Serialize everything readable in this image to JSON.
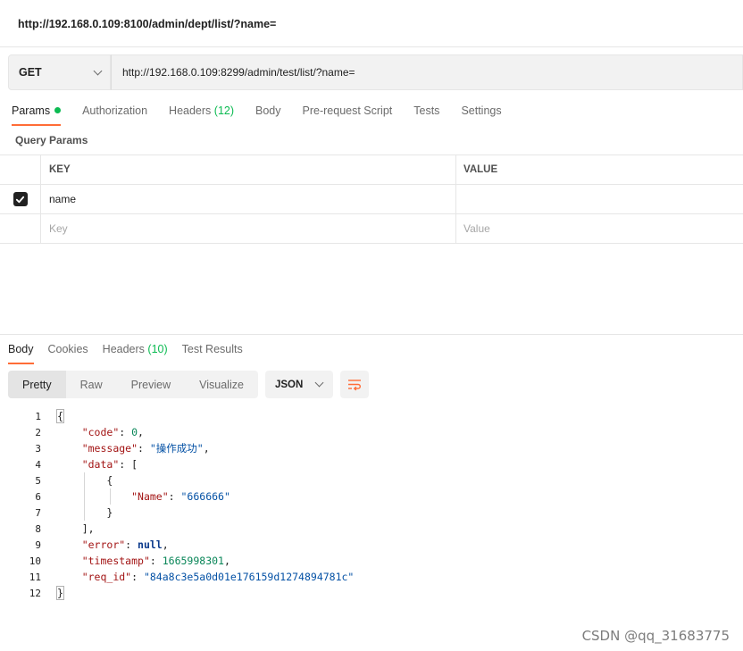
{
  "tab_title": "http://192.168.0.109:8100/admin/dept/list/?name=",
  "request": {
    "method": "GET",
    "url": "http://192.168.0.109:8299/admin/test/list/?name="
  },
  "request_tabs": [
    {
      "label": "Params"
    },
    {
      "label": "Authorization"
    },
    {
      "label": "Headers",
      "count": "(12)"
    },
    {
      "label": "Body"
    },
    {
      "label": "Pre-request Script"
    },
    {
      "label": "Tests"
    },
    {
      "label": "Settings"
    }
  ],
  "query_params": {
    "title": "Query Params",
    "headers": {
      "key": "KEY",
      "value": "VALUE"
    },
    "rows": [
      {
        "key": "name",
        "value": "",
        "checked": true
      }
    ],
    "placeholder": {
      "key": "Key",
      "value": "Value"
    }
  },
  "response_tabs": [
    {
      "label": "Body"
    },
    {
      "label": "Cookies"
    },
    {
      "label": "Headers",
      "count": "(10)"
    },
    {
      "label": "Test Results"
    }
  ],
  "view_modes": [
    "Pretty",
    "Raw",
    "Preview",
    "Visualize"
  ],
  "format": "JSON",
  "response": {
    "code": "0",
    "message": "\"操作成功\"",
    "data_name": "\"666666\"",
    "error": "null",
    "timestamp": "1665998301",
    "req_id": "\"84a8c3e5a0d01e176159d1274894781c\""
  },
  "watermark": "CSDN @qq_31683775"
}
